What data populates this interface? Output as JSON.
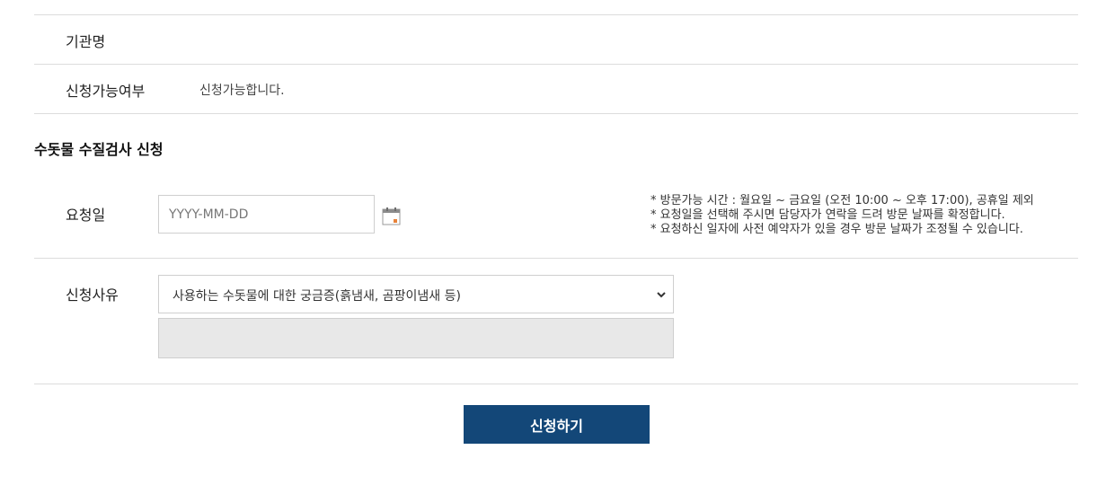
{
  "info": {
    "agency_label": "기관명",
    "agency_value": "",
    "availability_label": "신청가능여부",
    "availability_value": "신청가능합니다."
  },
  "section_title": "수돗물 수질검사 신청",
  "request_date": {
    "label": "요청일",
    "placeholder": "YYYY-MM-DD",
    "value": ""
  },
  "notes": [
    "* 방문가능 시간 : 월요일 ~ 금요일 (오전 10:00 ~ 오후 17:00), 공휴일 제외",
    "* 요청일을 선택해 주시면 담당자가 연락을 드려 방문 날짜를 확정합니다.",
    "* 요청하신 일자에 사전 예약자가 있을 경우 방문 날짜가 조정될 수 있습니다."
  ],
  "reason": {
    "label": "신청사유",
    "selected": "사용하는 수돗물에 대한 궁금증(흙냄새, 곰팡이냄새 등)",
    "detail": ""
  },
  "submit_label": "신청하기",
  "icons": {
    "calendar": "calendar-icon",
    "dropdown": "chevron-down-icon"
  },
  "colors": {
    "primary_button": "#134778",
    "calendar_accent": "#e8833a",
    "disabled_field": "#e8e8e8"
  }
}
